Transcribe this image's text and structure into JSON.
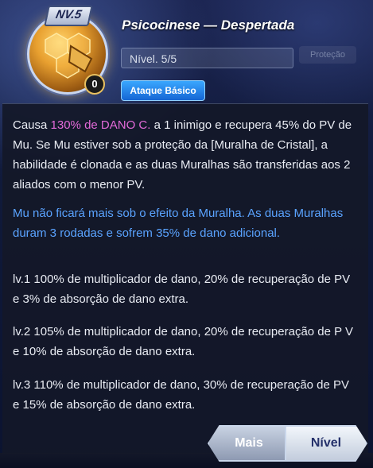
{
  "header": {
    "nv_badge": "NV.5",
    "lock_count": "0",
    "title": "Psicocinese — Despertada",
    "level": "Nível. 5/5",
    "type_tag": "Ataque Básico",
    "ghost_label": "Proteção"
  },
  "description": {
    "part1": "Causa ",
    "highlight": "130% de DANO C.",
    "part2": " a 1 inimigo e recupera 45% do PV de Mu. Se Mu estiver sob a proteção da [Muralha de Cristal], a habilidade é clonada e as duas Muralhas são transferidas aos 2 aliados com o menor PV.",
    "blue_note": "Mu não ficará mais sob o efeito da Muralha. As duas Muralhas duram 3 rodadas e sofrem 35% de dano adicional."
  },
  "levels": [
    "lv.1 100% de multiplicador de dano, 20% de recuperação de PV e 3% de absorção de dano extra.",
    "lv.2 105% de multiplicador de dano, 20% de recuperação de P V e 10% de absorção de dano extra.",
    "lv.3 110% de multiplicador de dano, 30% de recuperação de PV e 15% de absorção de dano extra."
  ],
  "buttons": {
    "more": "Mais",
    "level": "Nível"
  },
  "colors": {
    "highlight": "#e26ad8",
    "blue_note": "#5aa3ff",
    "tag": "#1f7fe6"
  }
}
